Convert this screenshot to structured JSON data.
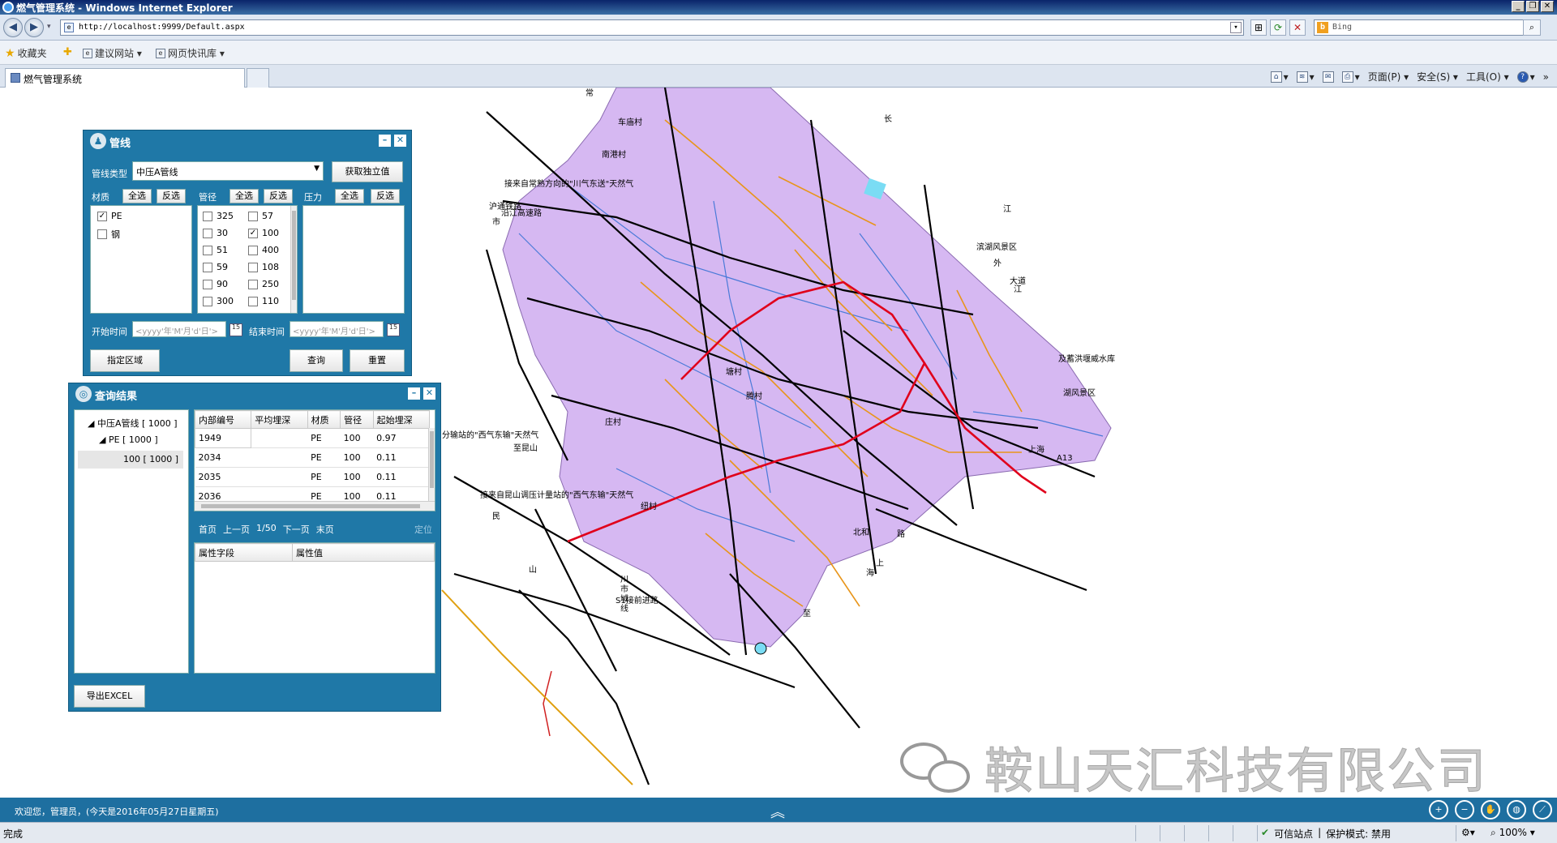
{
  "window": {
    "title": "燃气管理系统 - Windows Internet Explorer"
  },
  "address": {
    "url": "http://localhost:9999/Default.aspx",
    "search_provider": "Bing"
  },
  "favorites": {
    "label": "收藏夹",
    "items": [
      "建议网站 ▾",
      "网页快讯库 ▾"
    ]
  },
  "tab": {
    "title": "燃气管理系统"
  },
  "commands": [
    "页面(P) ▾",
    "安全(S) ▾",
    "工具(O) ▾"
  ],
  "pipeline_panel": {
    "title": "管线",
    "pipe_type_label": "管线类型",
    "pipe_type_value": "中压A管线",
    "get_unique_button": "获取独立值",
    "material_label": "材质",
    "diameter_label": "管径",
    "pressure_label": "压力",
    "select_all": "全选",
    "invert": "反选",
    "materials": [
      {
        "label": "PE",
        "checked": true
      },
      {
        "label": "钢",
        "checked": false
      }
    ],
    "diameters_col1": [
      {
        "label": "325",
        "checked": false
      },
      {
        "label": "30",
        "checked": false
      },
      {
        "label": "51",
        "checked": false
      },
      {
        "label": "59",
        "checked": false
      },
      {
        "label": "90",
        "checked": false
      },
      {
        "label": "300",
        "checked": false
      }
    ],
    "diameters_col2": [
      {
        "label": "57",
        "checked": false
      },
      {
        "label": "100",
        "checked": true
      },
      {
        "label": "400",
        "checked": false
      },
      {
        "label": "108",
        "checked": false
      },
      {
        "label": "250",
        "checked": false
      },
      {
        "label": "110",
        "checked": false
      }
    ],
    "start_time_label": "开始时间",
    "end_time_label": "结束时间",
    "date_placeholder": "<yyyy'年'M'月'd'日'>",
    "calendar_day": "15",
    "region_button": "指定区域",
    "query_button": "查询",
    "reset_button": "重置"
  },
  "results_panel": {
    "title": "查询结果",
    "tree": [
      {
        "label": "◢ 中压A管线 [ 1000 ]"
      },
      {
        "label": "◢ PE [ 1000 ]"
      },
      {
        "label": "100 [ 1000 ]"
      }
    ],
    "columns": [
      "内部编号",
      "平均埋深",
      "材质",
      "管径",
      "起始埋深"
    ],
    "rows": [
      [
        "1949",
        "",
        "PE",
        "100",
        "0.97"
      ],
      [
        "2034",
        "",
        "PE",
        "100",
        "0.11"
      ],
      [
        "2035",
        "",
        "PE",
        "100",
        "0.11"
      ],
      [
        "2036",
        "",
        "PE",
        "100",
        "0.11"
      ]
    ],
    "pager": {
      "first": "首页",
      "prev": "上一页",
      "page": "1/50",
      "next": "下一页",
      "last": "末页",
      "locate": "定位"
    },
    "attr_columns": [
      "属性字段",
      "属性值"
    ],
    "export_button": "导出EXCEL"
  },
  "map": {
    "labels": [
      "常",
      "长",
      "江",
      "车庙村",
      "南港村",
      "接来自常熟方向的\"川气东送\"天然气",
      "沪通铁路",
      "沿江高速路",
      "市",
      "滨湖风景区",
      "外",
      "大道",
      "江",
      "及蓄洪堰威水库",
      "湖风景区",
      "分输站的\"西气东输\"天然气",
      "至昆山",
      "接来自昆山调压计量站的\"西气东输\"天然气",
      "民",
      "山",
      "川",
      "市",
      "域",
      "S1接前进路",
      "线",
      "至",
      "上",
      "海",
      "A13",
      "上海",
      "北和",
      "路",
      "庄村",
      "腾村",
      "塘村",
      "纽村"
    ],
    "watermark": "鞍山天汇科技有限公司",
    "colors": {
      "district_fill": "#d6b8f2",
      "road": "#000000",
      "gas_main": "#e8951a",
      "high_pressure": "#e0001b",
      "river": "#4a7ad8"
    }
  },
  "app_status": {
    "welcome": "欢迎您，管理员，(今天是2016年05月27日星期五)",
    "collapse_icon": "︽"
  },
  "ie_status": {
    "left": "完成",
    "zone": "可信站点",
    "protected_mode": "保护模式: 禁用",
    "zoom": "100%"
  }
}
